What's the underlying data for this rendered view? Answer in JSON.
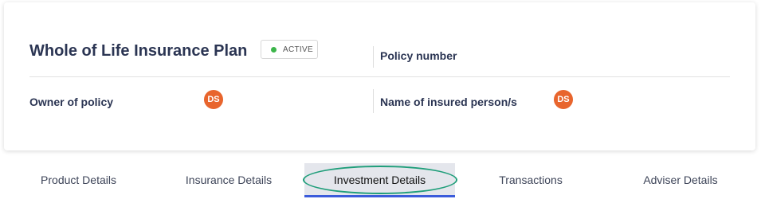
{
  "policy": {
    "title": "Whole of Life Insurance Plan",
    "status": "ACTIVE",
    "status_color": "#3cb54a",
    "policy_number_label": "Policy number",
    "owner_label": "Owner of policy",
    "owner_initials": "DS",
    "insured_label": "Name of insured person/s",
    "insured_initials": "DS",
    "avatar_color": "#e8652d"
  },
  "tabs": [
    {
      "label": "Product Details",
      "active": false
    },
    {
      "label": "Insurance Details",
      "active": false
    },
    {
      "label": "Investment Details",
      "active": true
    },
    {
      "label": "Transactions",
      "active": false
    },
    {
      "label": "Adviser Details",
      "active": false
    }
  ],
  "colors": {
    "heading": "#2b3553",
    "active_underline": "#3b5bdb",
    "annotation_ellipse": "#1f9e7a"
  }
}
